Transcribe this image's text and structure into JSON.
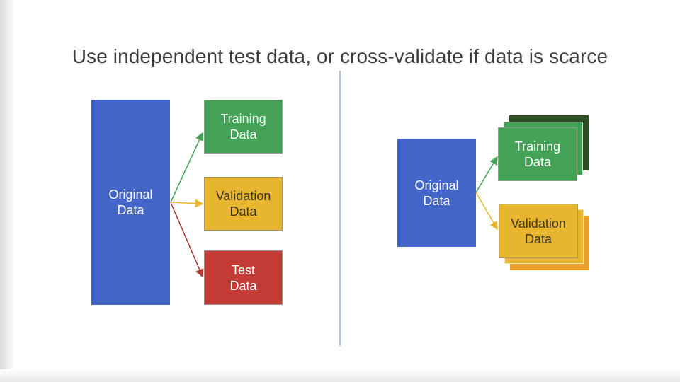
{
  "title": "Use independent test data, or cross-validate if data is scarce",
  "left": {
    "original": "Original\nData",
    "training": "Training\nData",
    "validation": "Validation\nData",
    "test": "Test\nData"
  },
  "right": {
    "original": "Original\nData",
    "training": "Training\nData",
    "validation": "Validation\nData"
  },
  "colors": {
    "original": "#4366c8",
    "training": "#43a255",
    "validation": "#e8b62e",
    "test": "#c23b35",
    "divider": "#a8c1e6"
  }
}
